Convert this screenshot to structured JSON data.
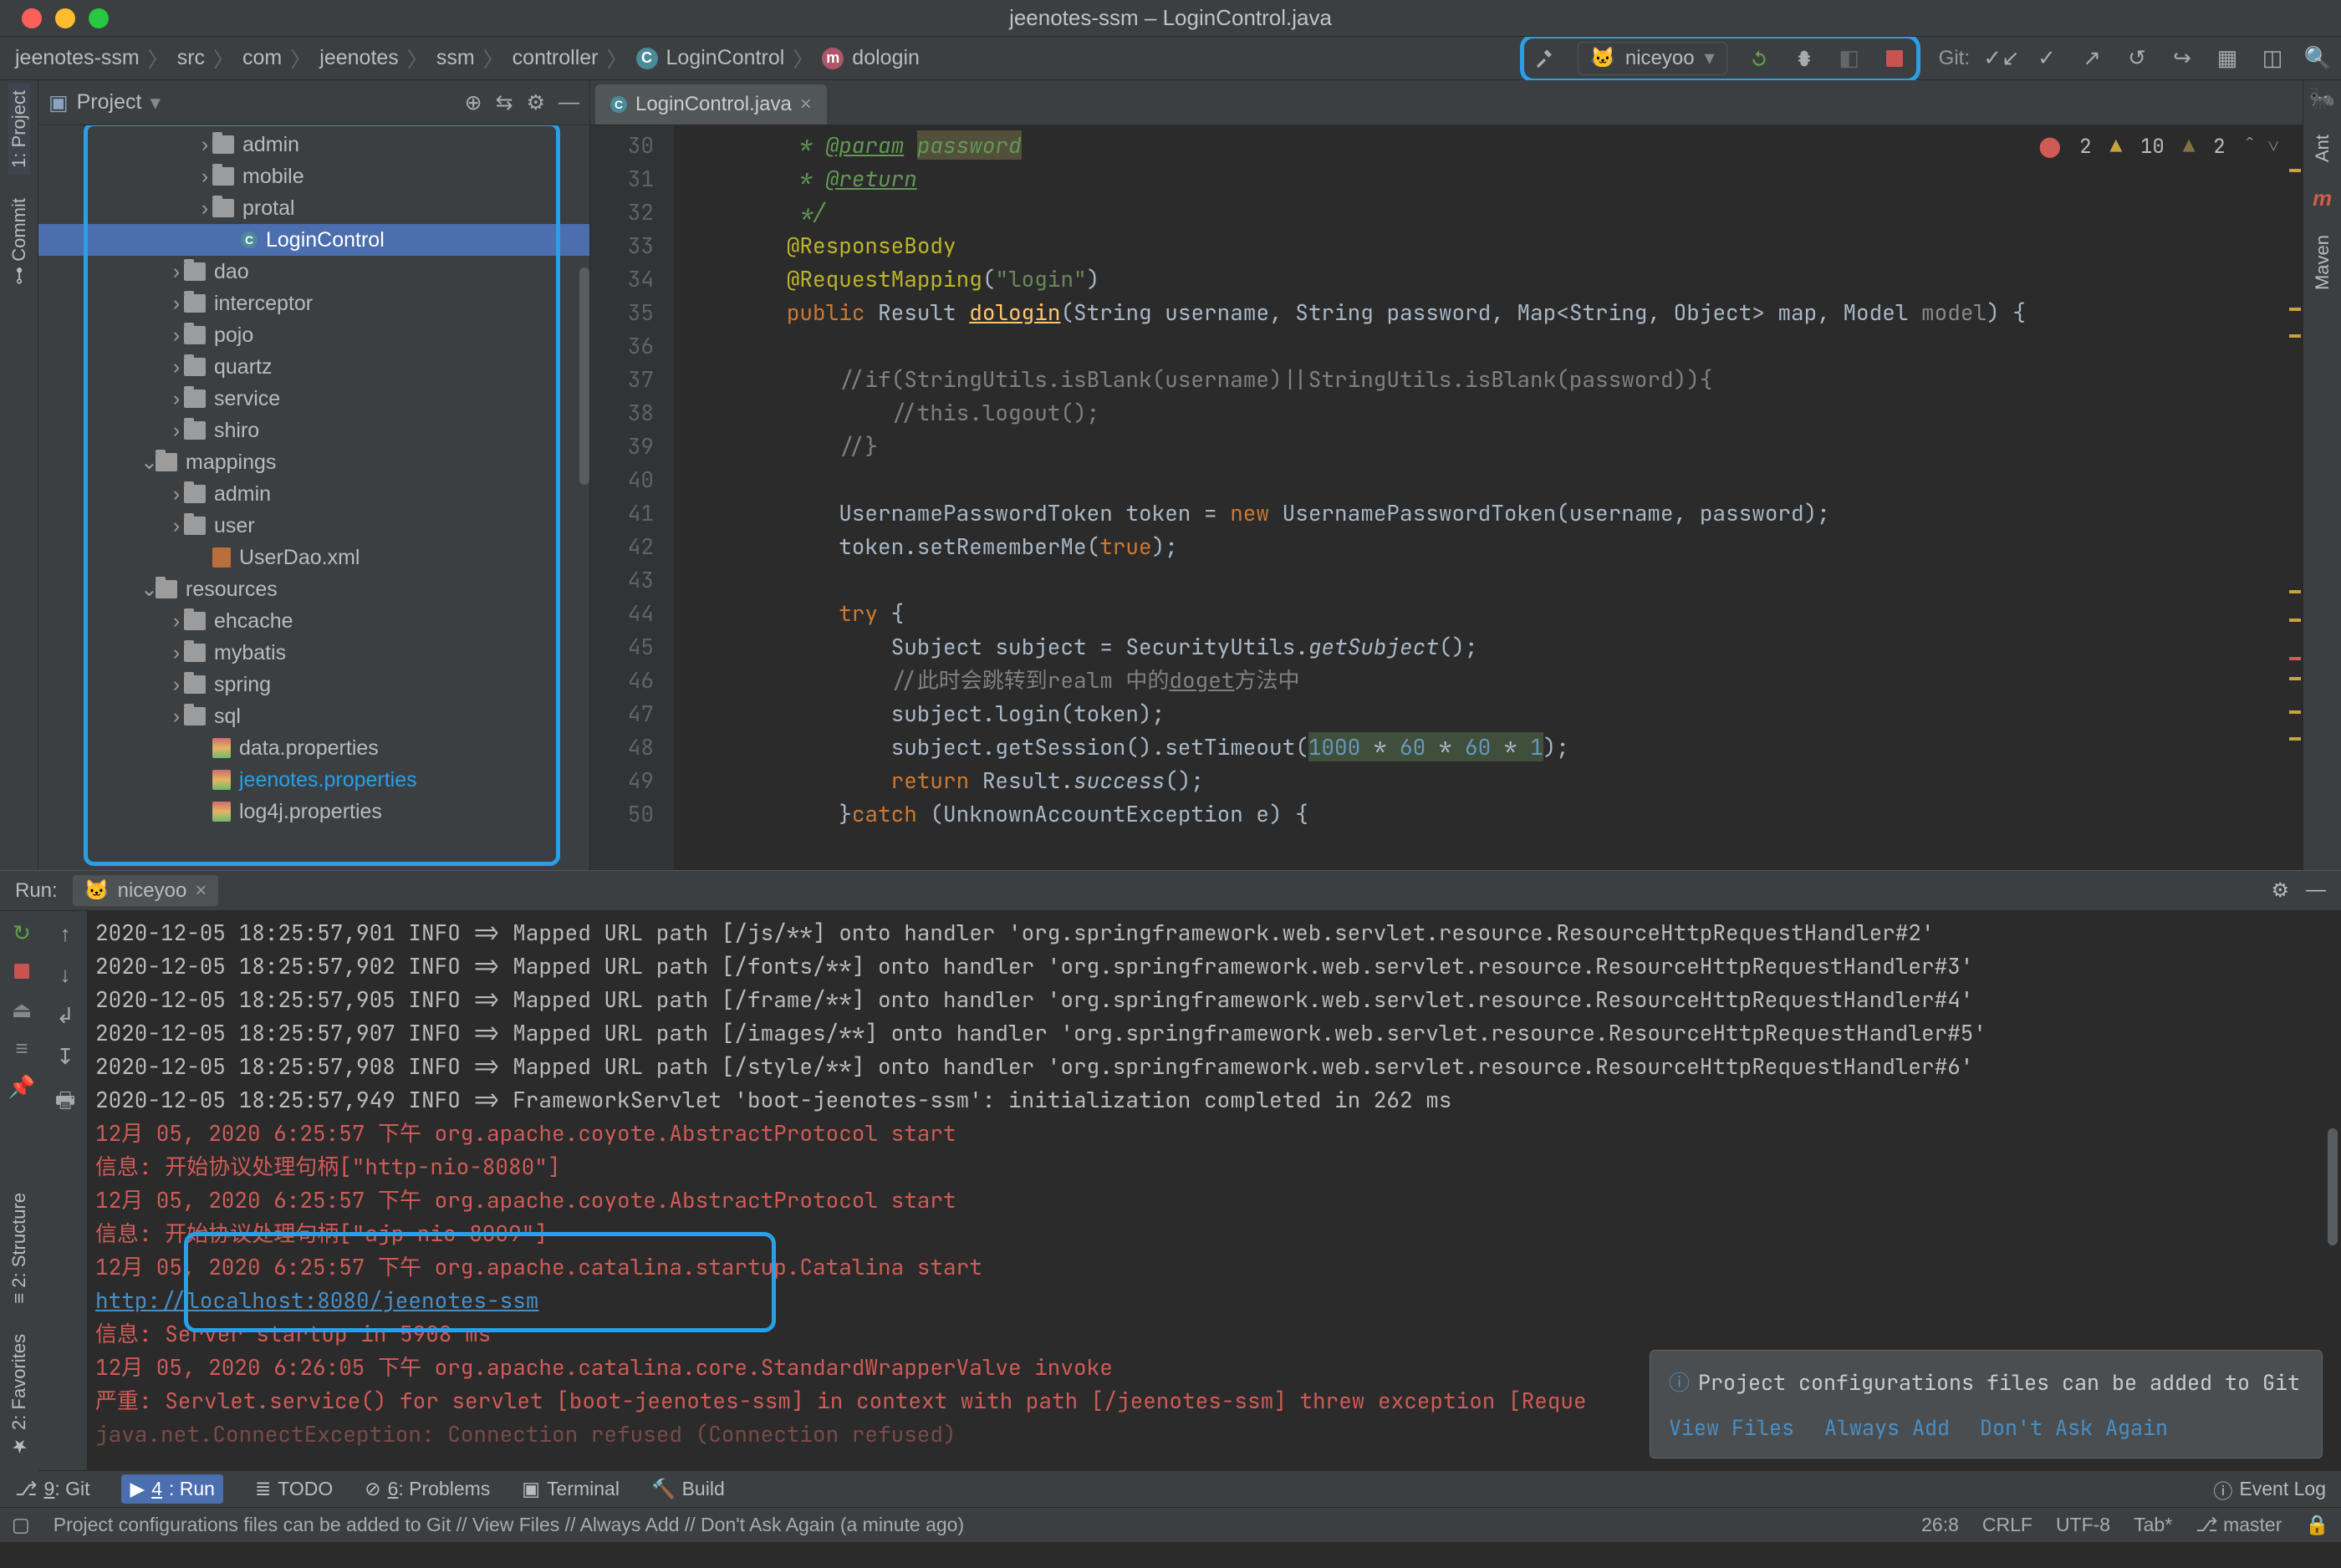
{
  "window": {
    "title": "jeenotes-ssm – LoginControl.java"
  },
  "breadcrumbs": [
    "jeenotes-ssm",
    "src",
    "com",
    "jeenotes",
    "ssm",
    "controller",
    "LoginControl",
    "dologin"
  ],
  "toolbar": {
    "run_config": "niceyoo",
    "git_label": "Git:"
  },
  "project": {
    "header": "Project",
    "tree": [
      {
        "depth": 5,
        "arrow": ">",
        "kind": "folder",
        "label": "admin"
      },
      {
        "depth": 5,
        "arrow": ">",
        "kind": "folder",
        "label": "mobile"
      },
      {
        "depth": 5,
        "arrow": ">",
        "kind": "folder",
        "label": "protal"
      },
      {
        "depth": 6,
        "arrow": "",
        "kind": "class",
        "label": "LoginControl",
        "selected": true
      },
      {
        "depth": 4,
        "arrow": ">",
        "kind": "folder",
        "label": "dao"
      },
      {
        "depth": 4,
        "arrow": ">",
        "kind": "folder",
        "label": "interceptor"
      },
      {
        "depth": 4,
        "arrow": ">",
        "kind": "folder",
        "label": "pojo"
      },
      {
        "depth": 4,
        "arrow": ">",
        "kind": "folder",
        "label": "quartz"
      },
      {
        "depth": 4,
        "arrow": ">",
        "kind": "folder",
        "label": "service"
      },
      {
        "depth": 4,
        "arrow": ">",
        "kind": "folder",
        "label": "shiro"
      },
      {
        "depth": 3,
        "arrow": "v",
        "kind": "folder",
        "label": "mappings"
      },
      {
        "depth": 4,
        "arrow": ">",
        "kind": "folder",
        "label": "admin"
      },
      {
        "depth": 4,
        "arrow": ">",
        "kind": "folder",
        "label": "user"
      },
      {
        "depth": 5,
        "arrow": "",
        "kind": "xml",
        "label": "UserDao.xml"
      },
      {
        "depth": 3,
        "arrow": "v",
        "kind": "folder",
        "label": "resources"
      },
      {
        "depth": 4,
        "arrow": ">",
        "kind": "folder",
        "label": "ehcache"
      },
      {
        "depth": 4,
        "arrow": ">",
        "kind": "folder",
        "label": "mybatis"
      },
      {
        "depth": 4,
        "arrow": ">",
        "kind": "folder",
        "label": "spring"
      },
      {
        "depth": 4,
        "arrow": ">",
        "kind": "folder",
        "label": "sql"
      },
      {
        "depth": 5,
        "arrow": "",
        "kind": "prop",
        "label": "data.properties"
      },
      {
        "depth": 5,
        "arrow": "",
        "kind": "prop",
        "label": "jeenotes.properties",
        "hl": true
      },
      {
        "depth": 5,
        "arrow": "",
        "kind": "prop",
        "label": "log4j.properties"
      }
    ]
  },
  "editor": {
    "tab": "LoginControl.java",
    "gutter_start": 30,
    "inspection": {
      "errors": "2",
      "warnings": "10",
      "weak": "2"
    },
    "lines": [
      {
        "n": 30,
        "html": "         * <u class='doc'>@param</u> <span class='doc-hl'>password</span>",
        "cls": "doc"
      },
      {
        "n": 31,
        "html": "         * <u class='doc'>@return</u>",
        "cls": "doc"
      },
      {
        "n": 32,
        "html": "         */",
        "cls": "doc"
      },
      {
        "n": 33,
        "html": "        <span class='ann'>@ResponseBody</span>"
      },
      {
        "n": 34,
        "html": "        <span class='ann'>@RequestMapping</span>(<span class='str'>\"login\"</span>)"
      },
      {
        "n": 35,
        "html": "        <span class='kw'>public</span> Result <span class='fn'><u>dologin</u></span>(String username, String password, Map&lt;String, Object&gt; map, Model <span style='color:#86898c'>model</span>) {"
      },
      {
        "n": 36,
        "html": ""
      },
      {
        "n": 37,
        "html": "            <span class='com'>//if(StringUtils.isBlank(username)||StringUtils.isBlank(password)){</span>"
      },
      {
        "n": 38,
        "html": "                <span class='com'>//this.logout();</span>"
      },
      {
        "n": 39,
        "html": "            <span class='com'>//}</span>"
      },
      {
        "n": 40,
        "html": ""
      },
      {
        "n": 41,
        "html": "            UsernamePasswordToken token = <span class='kw'>new</span> UsernamePasswordToken(username, password);"
      },
      {
        "n": 42,
        "html": "            token.setRememberMe(<span class='kw'>true</span>);"
      },
      {
        "n": 43,
        "html": ""
      },
      {
        "n": 44,
        "html": "            <span class='kw'>try</span> {"
      },
      {
        "n": 45,
        "html": "                Subject subject = SecurityUtils.<span style='font-style:italic'>getSubject</span>();"
      },
      {
        "n": 46,
        "html": "                <span class='com'>//此时会跳转到realm 中的<u>doget</u>方法中</span>"
      },
      {
        "n": 47,
        "html": "                subject.login(token);"
      },
      {
        "n": 48,
        "html": "                subject.getSession().setTimeout(<span class='const-hl'><span class='num'>1000</span> * <span class='num'>60</span> * <span class='num'>60</span> * <span class='num'>1</span></span>);"
      },
      {
        "n": 49,
        "html": "                <span class='kw'>return</span> Result.<span style='font-style:italic'>success</span>();"
      },
      {
        "n": 50,
        "html": "            }<span class='kw'>catch</span> (UnknownAccountException e) {"
      }
    ]
  },
  "left_rail": [
    "1: Project",
    "Commit"
  ],
  "left_rail_bottom": [
    "2: Favorites",
    "2: Structure"
  ],
  "right_rail": [
    "Ant",
    "Maven"
  ],
  "run": {
    "label": "Run:",
    "tab": "niceyoo",
    "lines": [
      {
        "cls": "log",
        "text": "2020-12-05 18:25:57,901 INFO  => Mapped URL path [/js/**] onto handler 'org.springframework.web.servlet.resource.ResourceHttpRequestHandler#2'"
      },
      {
        "cls": "log",
        "text": "2020-12-05 18:25:57,902 INFO  => Mapped URL path [/fonts/**] onto handler 'org.springframework.web.servlet.resource.ResourceHttpRequestHandler#3'"
      },
      {
        "cls": "log",
        "text": "2020-12-05 18:25:57,905 INFO  => Mapped URL path [/frame/**] onto handler 'org.springframework.web.servlet.resource.ResourceHttpRequestHandler#4'"
      },
      {
        "cls": "log",
        "text": "2020-12-05 18:25:57,907 INFO  => Mapped URL path [/images/**] onto handler 'org.springframework.web.servlet.resource.ResourceHttpRequestHandler#5'"
      },
      {
        "cls": "log",
        "text": "2020-12-05 18:25:57,908 INFO  => Mapped URL path [/style/**] onto handler 'org.springframework.web.servlet.resource.ResourceHttpRequestHandler#6'"
      },
      {
        "cls": "log",
        "text": "2020-12-05 18:25:57,949 INFO  => FrameworkServlet 'boot-jeenotes-ssm': initialization completed in 262 ms"
      },
      {
        "cls": "red",
        "text": "12月 05, 2020 6:25:57 下午 org.apache.coyote.AbstractProtocol start"
      },
      {
        "cls": "red",
        "text": "信息: 开始协议处理句柄[\"http-nio-8080\"]"
      },
      {
        "cls": "red",
        "text": "12月 05, 2020 6:25:57 下午 org.apache.coyote.AbstractProtocol start"
      },
      {
        "cls": "red",
        "text": "信息: 开始协议处理句柄[\"ajp-nio-8009\"]"
      },
      {
        "cls": "red",
        "text": "12月 05, 2020 6:25:57 下午 org.apache.catalina.startup.Catalina start"
      },
      {
        "cls": "link",
        "text": "http://localhost:8080/jeenotes-ssm"
      },
      {
        "cls": "red",
        "text": "信息: Server startup in 5908 ms"
      },
      {
        "cls": "red",
        "text": "12月 05, 2020 6:26:05 下午 org.apache.catalina.core.StandardWrapperValve invoke"
      },
      {
        "cls": "red",
        "text": "严重: Servlet.service() for servlet [boot-jeenotes-ssm] in context with path [/jeenotes-ssm] threw exception [Reque"
      },
      {
        "cls": "faded",
        "text": "java.net.ConnectException: Connection refused (Connection refused)"
      }
    ],
    "notification": {
      "text": "Project configurations files can be added to Git",
      "actions": [
        "View Files",
        "Always Add",
        "Don't Ask Again"
      ]
    }
  },
  "bottom_tabs": [
    "9: Git",
    "4: Run",
    "TODO",
    "6: Problems",
    "Terminal",
    "Build"
  ],
  "bottom_right": "Event Log",
  "status": {
    "msg": "Project configurations files can be added to Git // View Files // Always Add // Don't Ask Again (a minute ago)",
    "caret": "26:8",
    "eol": "CRLF",
    "enc": "UTF-8",
    "indent": "Tab*",
    "branch": "master"
  }
}
